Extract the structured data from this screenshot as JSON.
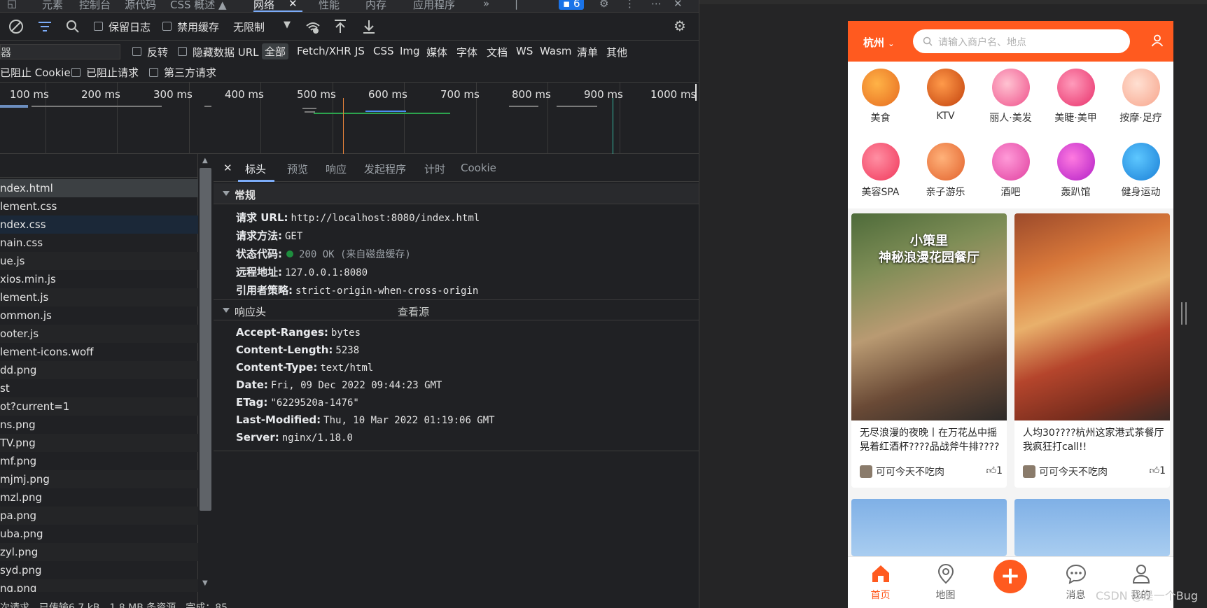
{
  "devtools": {
    "top_tabs": [
      "元素",
      "控制台",
      "源代码",
      "CSS 概述 ▲",
      "网络",
      "性能",
      "内存",
      "应用程序"
    ],
    "active_tab": "网络",
    "badge_count": "6",
    "toolbar": {
      "preserve_log": "保留日志",
      "disable_cache": "禁用缓存",
      "throttling": "无限制"
    },
    "filter": {
      "placeholder": "器",
      "invert": "反转",
      "hide_data_urls": "隐藏数据 URL",
      "types": [
        "全部",
        "Fetch/XHR",
        "JS",
        "CSS",
        "Img",
        "媒体",
        "字体",
        "文档",
        "WS",
        "Wasm",
        "清单",
        "其他"
      ],
      "blocked_cookies": "已阻止 Cookie",
      "blocked_requests": "已阻止请求",
      "third_party": "第三方请求"
    },
    "timeline_ticks": [
      "100 ms",
      "200 ms",
      "300 ms",
      "400 ms",
      "500 ms",
      "600 ms",
      "700 ms",
      "800 ms",
      "900 ms",
      "1000 ms"
    ],
    "requests": [
      "ndex.html",
      "lement.css",
      "ndex.css",
      "nain.css",
      "ue.js",
      "xios.min.js",
      "lement.js",
      "ommon.js",
      "ooter.js",
      "lement-icons.woff",
      "dd.png",
      "st",
      "ot?current=1",
      "ns.png",
      "TV.png",
      "mf.png",
      "mjmj.png",
      "mzl.png",
      "pa.png",
      "uba.png",
      "zyl.png",
      "syd.png",
      "ng.png"
    ],
    "status_bar": "次请求，已传输6.7 kB，1.8 MB 条资源，完成：85",
    "detail_tabs": [
      "标头",
      "预览",
      "响应",
      "发起程序",
      "计时",
      "Cookie"
    ],
    "general": {
      "title": "常规",
      "rows": [
        {
          "key": "请求 URL:",
          "value": "http://localhost:8080/index.html"
        },
        {
          "key": "请求方法:",
          "value": "GET"
        },
        {
          "key": "状态代码:",
          "value": "200 OK (来自磁盘缓存)"
        },
        {
          "key": "远程地址:",
          "value": "127.0.0.1:8080"
        },
        {
          "key": "引用者策略:",
          "value": "strict-origin-when-cross-origin"
        }
      ]
    },
    "response_headers": {
      "title": "响应头",
      "view_source": "查看源",
      "rows": [
        {
          "key": "Accept-Ranges:",
          "value": "bytes"
        },
        {
          "key": "Content-Length:",
          "value": "5238"
        },
        {
          "key": "Content-Type:",
          "value": "text/html"
        },
        {
          "key": "Date:",
          "value": "Fri, 09 Dec 2022 09:44:23 GMT"
        },
        {
          "key": "ETag:",
          "value": "\"6229520a-1476\""
        },
        {
          "key": "Last-Modified:",
          "value": "Thu, 10 Mar 2022 01:19:06 GMT"
        },
        {
          "key": "Server:",
          "value": "nginx/1.18.0"
        }
      ]
    }
  },
  "app": {
    "city": "杭州",
    "search_placeholder": "请输入商户名、地点",
    "brand_color": "#ff5a1f",
    "categories": [
      "美食",
      "KTV",
      "丽人·美发",
      "美睫·美甲",
      "按摩·足疗",
      "美容SPA",
      "亲子游乐",
      "酒吧",
      "轰趴馆",
      "健身运动"
    ],
    "posts": [
      {
        "overlay": "小策里\n神秘浪漫花园餐厅",
        "title": "无尽浪漫的夜晚丨在万花丛中摇晃着红酒杯????品战斧牛排????",
        "user": "可可今天不吃肉",
        "likes": "1"
      },
      {
        "overlay": "",
        "title": "人均30????杭州这家港式茶餐厅我疯狂打call!!",
        "user": "可可今天不吃肉",
        "likes": "1"
      }
    ],
    "tabs": [
      "首页",
      "地图",
      "",
      "消息",
      "我的"
    ]
  },
  "watermark": "CSDN @是一个Bug"
}
